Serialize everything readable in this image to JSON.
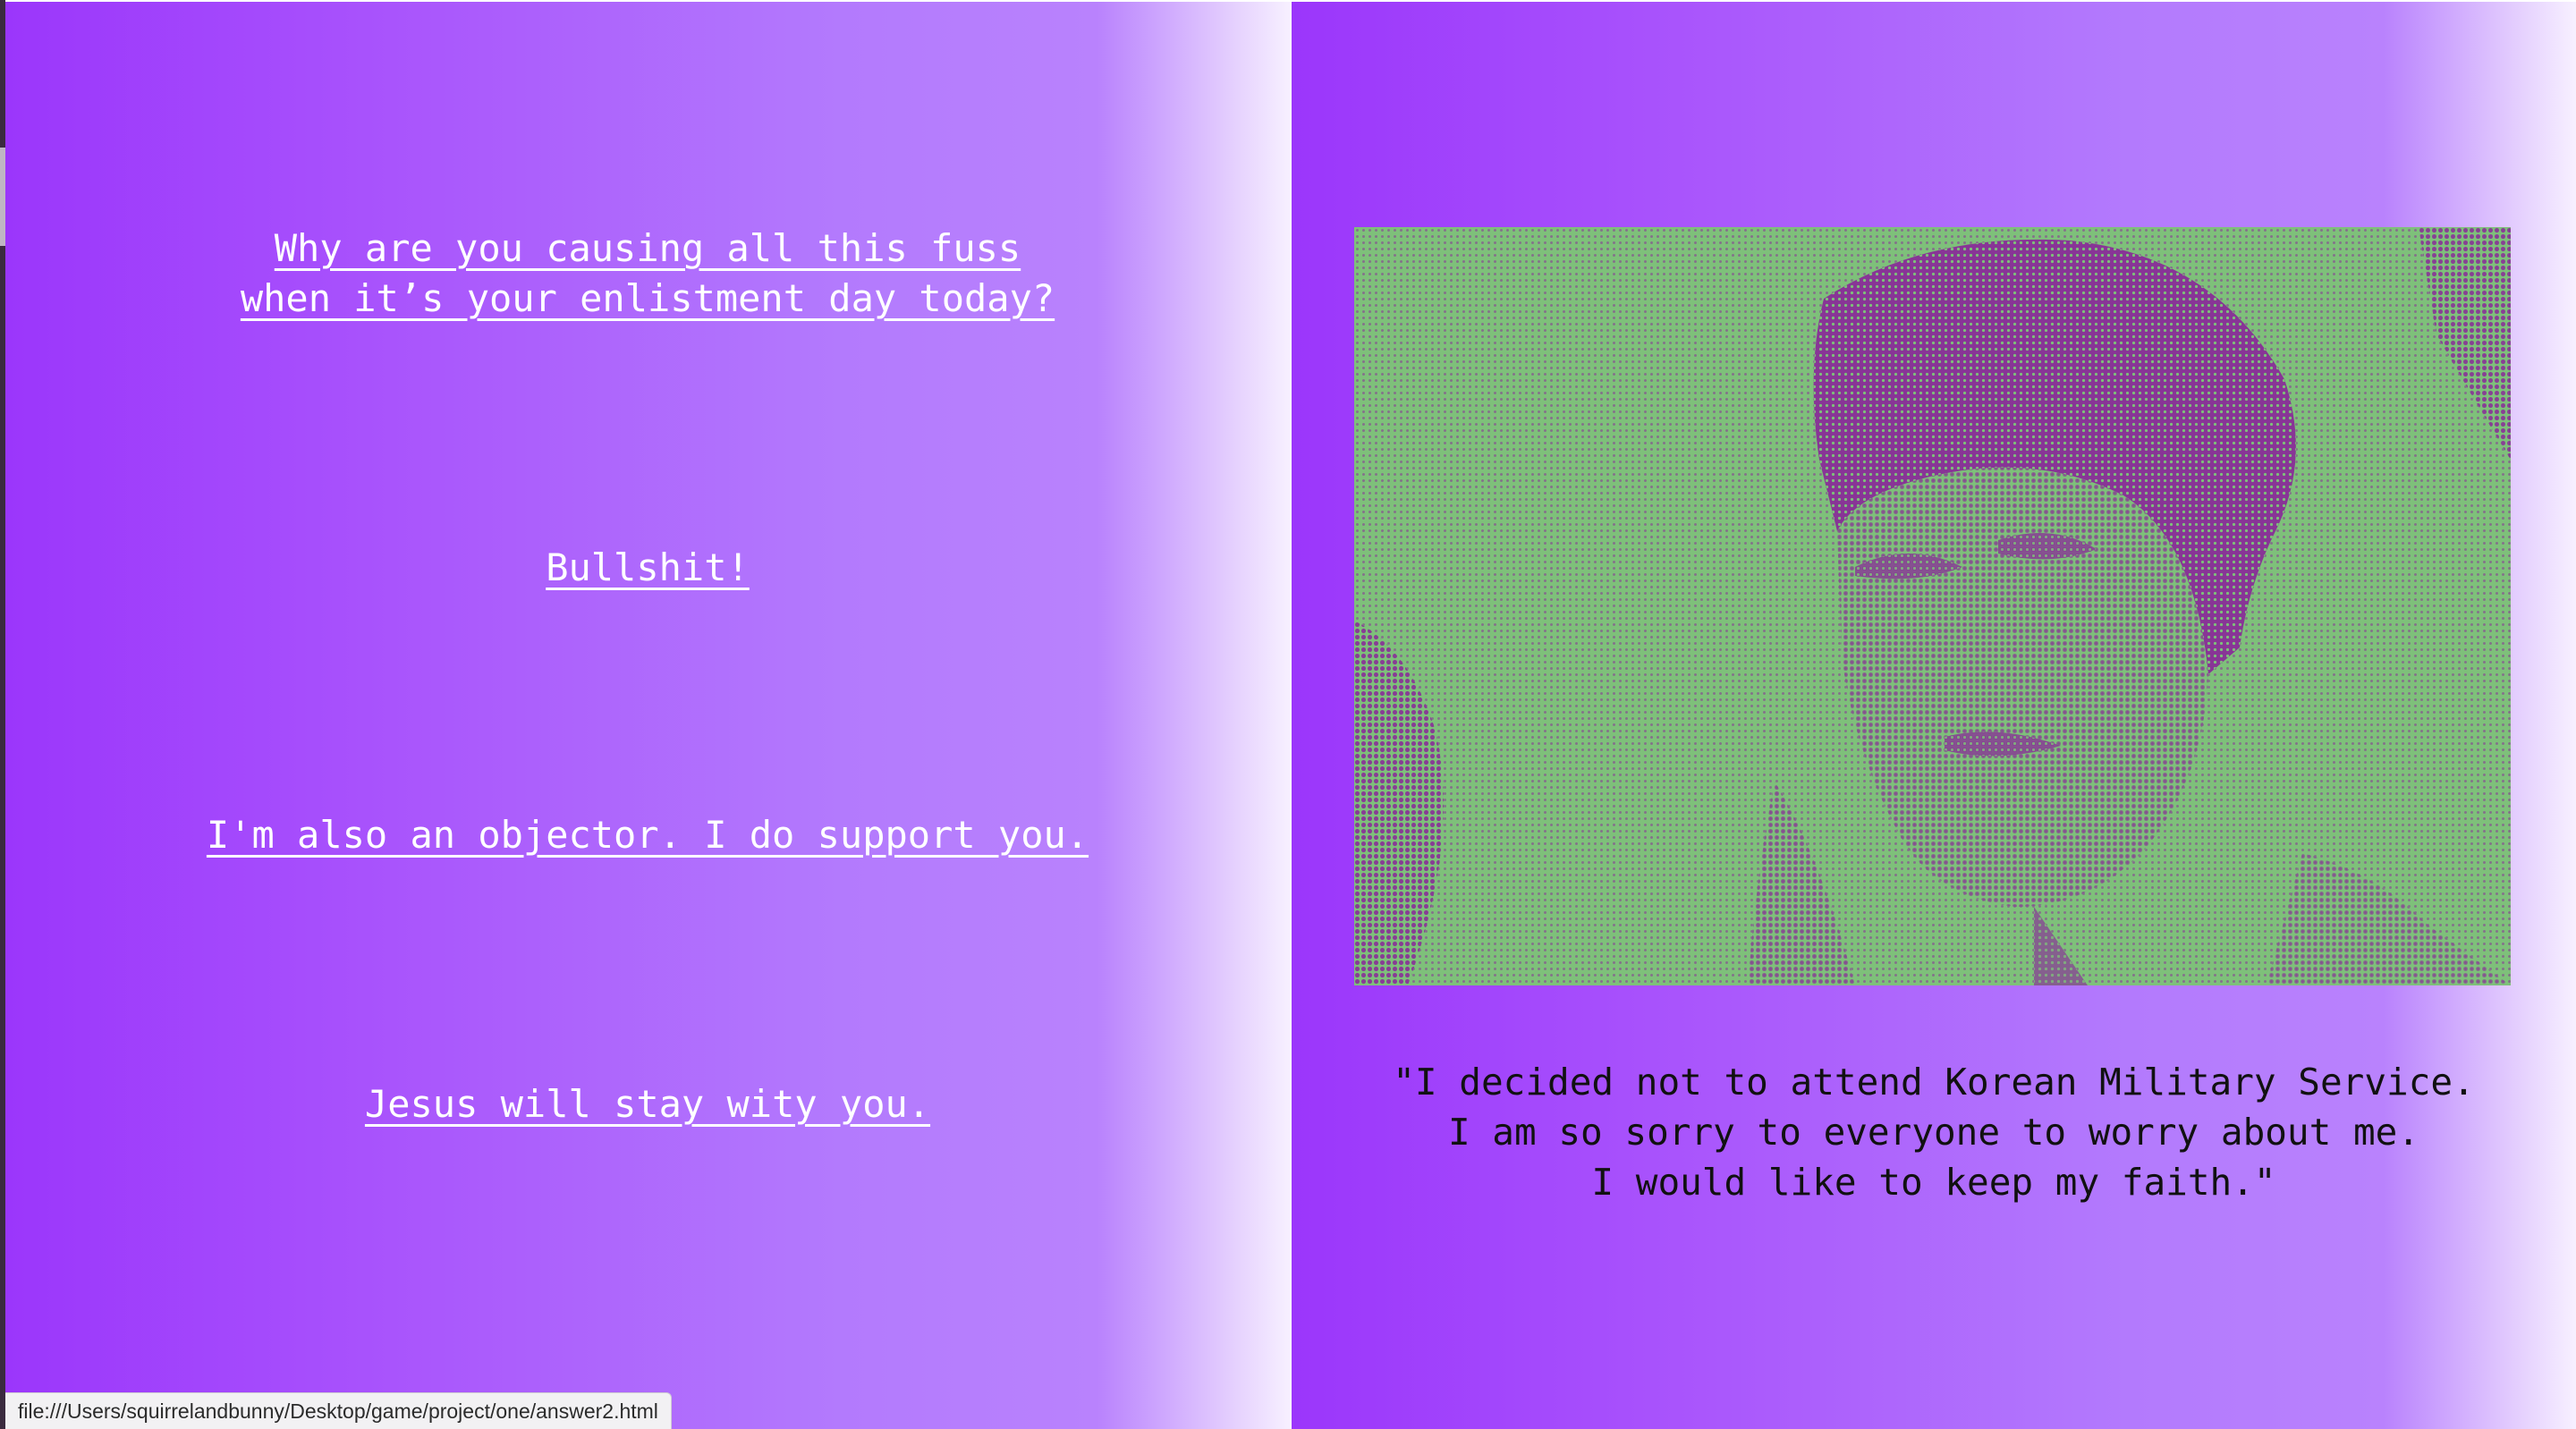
{
  "left_pane": {
    "choices": [
      {
        "lines": [
          "Why are you causing all this fuss",
          "when it’s your enlistment day today?"
        ]
      },
      {
        "lines": [
          "Bullshit!"
        ]
      },
      {
        "lines": [
          "I'm also an objector. I do support you."
        ]
      },
      {
        "lines": [
          "Jesus will stay wity you."
        ]
      }
    ]
  },
  "right_pane": {
    "quote_lines": [
      "\"I decided not to attend Korean Military Service.",
      "I am so sorry to everyone to worry about me.",
      "I would like to keep my faith.\""
    ]
  },
  "status_bar": {
    "url": "file:///Users/squirrelandbunny/Desktop/game/project/one/answer2.html"
  },
  "colors": {
    "gradient_start": "#9b36fb",
    "gradient_end": "#f7f0ff",
    "photo_green": "#7ec07a",
    "photo_purple": "#883596"
  },
  "icons": {
    "photo": "halftone-portrait"
  }
}
